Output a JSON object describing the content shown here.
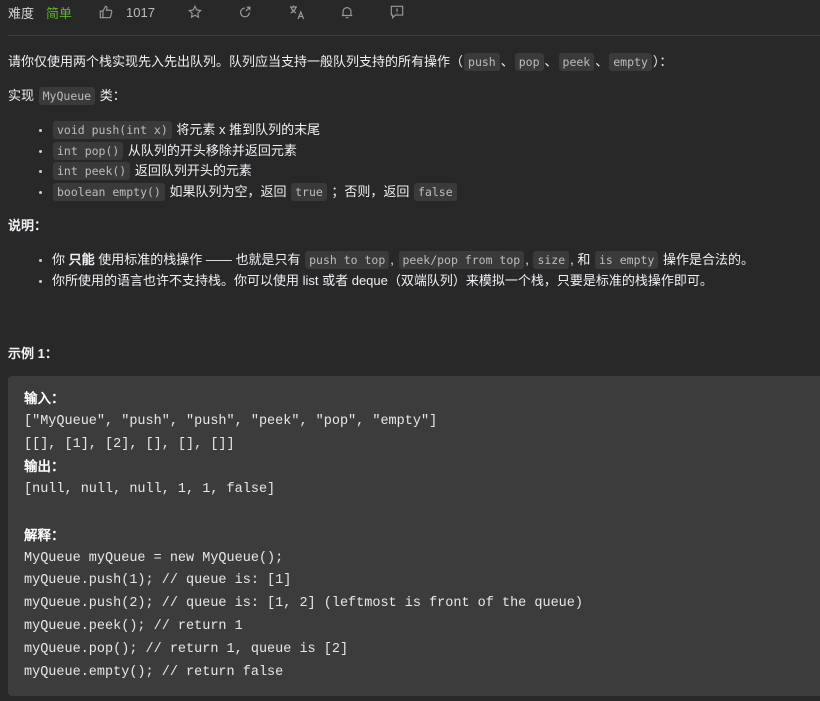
{
  "toolbar": {
    "difficulty_label": "难度",
    "difficulty_value": "简单",
    "difficulty_color": "#5ab726",
    "likes": "1017",
    "icons": [
      "thumbs-up-icon",
      "star-icon",
      "share-icon",
      "translate-icon",
      "bell-icon",
      "feedback-icon"
    ]
  },
  "description": {
    "intro": {
      "text_before": "请你仅使用两个栈实现先入先出队列。队列应当支持一般队列支持的所有操作（",
      "ops": [
        "push",
        "pop",
        "peek",
        "empty"
      ],
      "sep": "、",
      "text_after": "）："
    },
    "impl": {
      "before": "实现 ",
      "code": "MyQueue",
      "after": " 类："
    },
    "methods": [
      {
        "code": "void push(int x)",
        "desc": " 将元素 x 推到队列的末尾"
      },
      {
        "code": "int pop()",
        "desc": " 从队列的开头移除并返回元素"
      },
      {
        "code": "int peek()",
        "desc": " 返回队列开头的元素"
      },
      {
        "code": "boolean empty()",
        "desc": " 如果队列为空，返回 ",
        "code2": "true",
        "desc2": " ；否则，返回 ",
        "code3": "false"
      }
    ],
    "notes_title": "说明：",
    "notes": [
      {
        "t1": "你 ",
        "bold": "只能",
        "t2": " 使用标准的栈操作 —— 也就是只有 ",
        "c1": "push to top",
        "s1": ", ",
        "c2": "peek/pop from top",
        "s2": ", ",
        "c3": "size",
        "s3": ", 和 ",
        "c4": "is empty",
        "t3": " 操作是合法的。"
      },
      {
        "text": "你所使用的语言也许不支持栈。你可以使用 list 或者 deque（双端队列）来模拟一个栈，只要是标准的栈操作即可。"
      }
    ],
    "example_title": "示例 1："
  },
  "example": {
    "input_label": "输入：",
    "input_lines": [
      "[\"MyQueue\", \"push\", \"push\", \"peek\", \"pop\", \"empty\"]",
      "[[], [1], [2], [], [], []]"
    ],
    "output_label": "输出：",
    "output_line": "[null, null, null, 1, 1, false]",
    "explain_label": "解释：",
    "explain_lines": [
      "MyQueue myQueue = new MyQueue();",
      "myQueue.push(1); // queue is: [1]",
      "myQueue.push(2); // queue is: [1, 2] (leftmost is front of the queue)",
      "myQueue.peek(); // return 1",
      "myQueue.pop(); // return 1, queue is [2]",
      "myQueue.empty(); // return false"
    ]
  }
}
